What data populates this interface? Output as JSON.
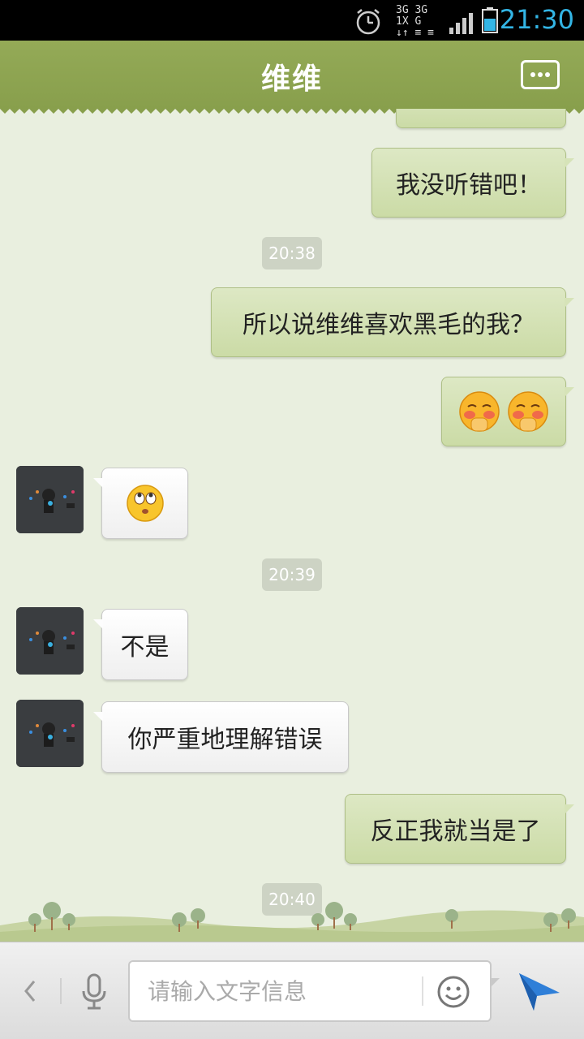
{
  "status_bar": {
    "net_line1": "3G 3G 1X G",
    "net_line2": "↓↑ ≡ ≡",
    "time": "21:30",
    "colors": {
      "time": "#33b5e5",
      "battery": "#33b5e5"
    }
  },
  "header": {
    "title": "维维",
    "more_icon": "more-dots-icon",
    "color": "#8fa553"
  },
  "messages": [
    {
      "type": "outgoing",
      "text": ""
    },
    {
      "type": "outgoing",
      "text": "我没听错吧！"
    },
    {
      "type": "timestamp",
      "text": "20:38"
    },
    {
      "type": "outgoing",
      "text": "所以说维维喜欢黑毛的我？"
    },
    {
      "type": "outgoing",
      "emoji": "shy-face-icon"
    },
    {
      "type": "incoming",
      "emoji": "rolling-eyes-face-icon"
    },
    {
      "type": "timestamp",
      "text": "20:39"
    },
    {
      "type": "incoming",
      "text": "不是"
    },
    {
      "type": "incoming",
      "text": "你严重地理解错误"
    },
    {
      "type": "outgoing",
      "text": "反正我就当是了"
    },
    {
      "type": "timestamp",
      "text": "20:40"
    },
    {
      "type": "incoming",
      "text": ""
    }
  ],
  "input_bar": {
    "placeholder": "请输入文字信息",
    "back_icon": "chevron-left-icon",
    "mic_icon": "microphone-icon",
    "emoji_icon": "smiley-icon",
    "send_icon": "send-arrow-icon",
    "send_color": "#2f7fd8"
  }
}
